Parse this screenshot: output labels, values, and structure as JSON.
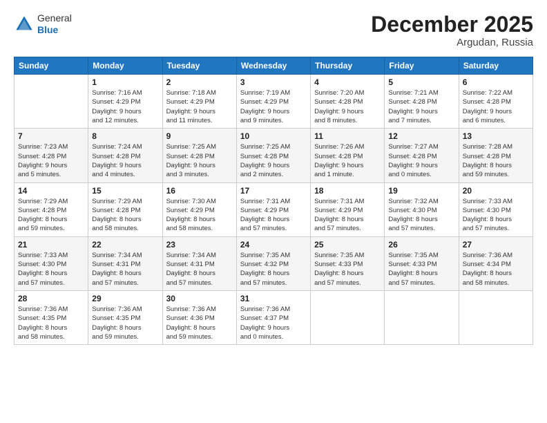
{
  "header": {
    "logo_general": "General",
    "logo_blue": "Blue",
    "title": "December 2025",
    "subtitle": "Argudan, Russia"
  },
  "weekdays": [
    "Sunday",
    "Monday",
    "Tuesday",
    "Wednesday",
    "Thursday",
    "Friday",
    "Saturday"
  ],
  "weeks": [
    [
      {
        "day": "",
        "info": ""
      },
      {
        "day": "1",
        "info": "Sunrise: 7:16 AM\nSunset: 4:29 PM\nDaylight: 9 hours\nand 12 minutes."
      },
      {
        "day": "2",
        "info": "Sunrise: 7:18 AM\nSunset: 4:29 PM\nDaylight: 9 hours\nand 11 minutes."
      },
      {
        "day": "3",
        "info": "Sunrise: 7:19 AM\nSunset: 4:29 PM\nDaylight: 9 hours\nand 9 minutes."
      },
      {
        "day": "4",
        "info": "Sunrise: 7:20 AM\nSunset: 4:28 PM\nDaylight: 9 hours\nand 8 minutes."
      },
      {
        "day": "5",
        "info": "Sunrise: 7:21 AM\nSunset: 4:28 PM\nDaylight: 9 hours\nand 7 minutes."
      },
      {
        "day": "6",
        "info": "Sunrise: 7:22 AM\nSunset: 4:28 PM\nDaylight: 9 hours\nand 6 minutes."
      }
    ],
    [
      {
        "day": "7",
        "info": "Sunrise: 7:23 AM\nSunset: 4:28 PM\nDaylight: 9 hours\nand 5 minutes."
      },
      {
        "day": "8",
        "info": "Sunrise: 7:24 AM\nSunset: 4:28 PM\nDaylight: 9 hours\nand 4 minutes."
      },
      {
        "day": "9",
        "info": "Sunrise: 7:25 AM\nSunset: 4:28 PM\nDaylight: 9 hours\nand 3 minutes."
      },
      {
        "day": "10",
        "info": "Sunrise: 7:25 AM\nSunset: 4:28 PM\nDaylight: 9 hours\nand 2 minutes."
      },
      {
        "day": "11",
        "info": "Sunrise: 7:26 AM\nSunset: 4:28 PM\nDaylight: 9 hours\nand 1 minute."
      },
      {
        "day": "12",
        "info": "Sunrise: 7:27 AM\nSunset: 4:28 PM\nDaylight: 9 hours\nand 0 minutes."
      },
      {
        "day": "13",
        "info": "Sunrise: 7:28 AM\nSunset: 4:28 PM\nDaylight: 8 hours\nand 59 minutes."
      }
    ],
    [
      {
        "day": "14",
        "info": "Sunrise: 7:29 AM\nSunset: 4:28 PM\nDaylight: 8 hours\nand 59 minutes."
      },
      {
        "day": "15",
        "info": "Sunrise: 7:29 AM\nSunset: 4:28 PM\nDaylight: 8 hours\nand 58 minutes."
      },
      {
        "day": "16",
        "info": "Sunrise: 7:30 AM\nSunset: 4:29 PM\nDaylight: 8 hours\nand 58 minutes."
      },
      {
        "day": "17",
        "info": "Sunrise: 7:31 AM\nSunset: 4:29 PM\nDaylight: 8 hours\nand 57 minutes."
      },
      {
        "day": "18",
        "info": "Sunrise: 7:31 AM\nSunset: 4:29 PM\nDaylight: 8 hours\nand 57 minutes."
      },
      {
        "day": "19",
        "info": "Sunrise: 7:32 AM\nSunset: 4:30 PM\nDaylight: 8 hours\nand 57 minutes."
      },
      {
        "day": "20",
        "info": "Sunrise: 7:33 AM\nSunset: 4:30 PM\nDaylight: 8 hours\nand 57 minutes."
      }
    ],
    [
      {
        "day": "21",
        "info": "Sunrise: 7:33 AM\nSunset: 4:30 PM\nDaylight: 8 hours\nand 57 minutes."
      },
      {
        "day": "22",
        "info": "Sunrise: 7:34 AM\nSunset: 4:31 PM\nDaylight: 8 hours\nand 57 minutes."
      },
      {
        "day": "23",
        "info": "Sunrise: 7:34 AM\nSunset: 4:31 PM\nDaylight: 8 hours\nand 57 minutes."
      },
      {
        "day": "24",
        "info": "Sunrise: 7:35 AM\nSunset: 4:32 PM\nDaylight: 8 hours\nand 57 minutes."
      },
      {
        "day": "25",
        "info": "Sunrise: 7:35 AM\nSunset: 4:33 PM\nDaylight: 8 hours\nand 57 minutes."
      },
      {
        "day": "26",
        "info": "Sunrise: 7:35 AM\nSunset: 4:33 PM\nDaylight: 8 hours\nand 57 minutes."
      },
      {
        "day": "27",
        "info": "Sunrise: 7:36 AM\nSunset: 4:34 PM\nDaylight: 8 hours\nand 58 minutes."
      }
    ],
    [
      {
        "day": "28",
        "info": "Sunrise: 7:36 AM\nSunset: 4:35 PM\nDaylight: 8 hours\nand 58 minutes."
      },
      {
        "day": "29",
        "info": "Sunrise: 7:36 AM\nSunset: 4:35 PM\nDaylight: 8 hours\nand 59 minutes."
      },
      {
        "day": "30",
        "info": "Sunrise: 7:36 AM\nSunset: 4:36 PM\nDaylight: 8 hours\nand 59 minutes."
      },
      {
        "day": "31",
        "info": "Sunrise: 7:36 AM\nSunset: 4:37 PM\nDaylight: 9 hours\nand 0 minutes."
      },
      {
        "day": "",
        "info": ""
      },
      {
        "day": "",
        "info": ""
      },
      {
        "day": "",
        "info": ""
      }
    ]
  ]
}
